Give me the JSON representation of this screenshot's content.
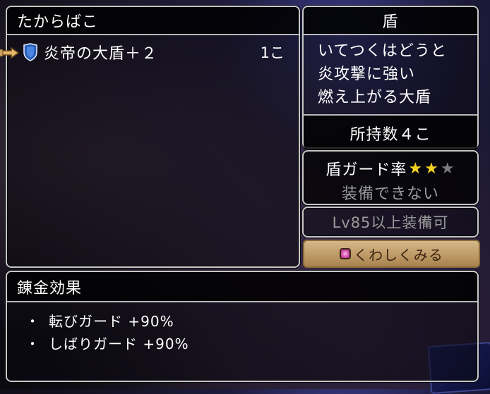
{
  "list_panel": {
    "title": "たからばこ",
    "items": [
      {
        "icon": "shield-icon",
        "name": "炎帝の大盾＋２",
        "quantity": "1こ"
      }
    ]
  },
  "detail_panel": {
    "title": "盾",
    "description_lines": [
      "いてつくはどうと",
      "炎攻撃に強い",
      "燃え上がる大盾"
    ],
    "owned_count": "所持数４こ"
  },
  "guard_panel": {
    "label": "盾ガード率",
    "stars_filled": 2,
    "stars_total": 3,
    "equip_status": "装備できない"
  },
  "level_panel": {
    "text": "Lv85以上装備可"
  },
  "detail_button": {
    "label": "くわしくみる",
    "icon": "square-button-icon"
  },
  "alchemy_panel": {
    "title": "錬金効果",
    "effects": [
      {
        "bullet": "・",
        "text": "転びガード +90%"
      },
      {
        "bullet": "・",
        "text": "しばりガード +90%"
      }
    ]
  },
  "colors": {
    "star_filled": "#f5d21e",
    "star_empty": "#7a7a7a",
    "disabled_text": "#9a9a9a",
    "button_bg": "#c19d69"
  }
}
